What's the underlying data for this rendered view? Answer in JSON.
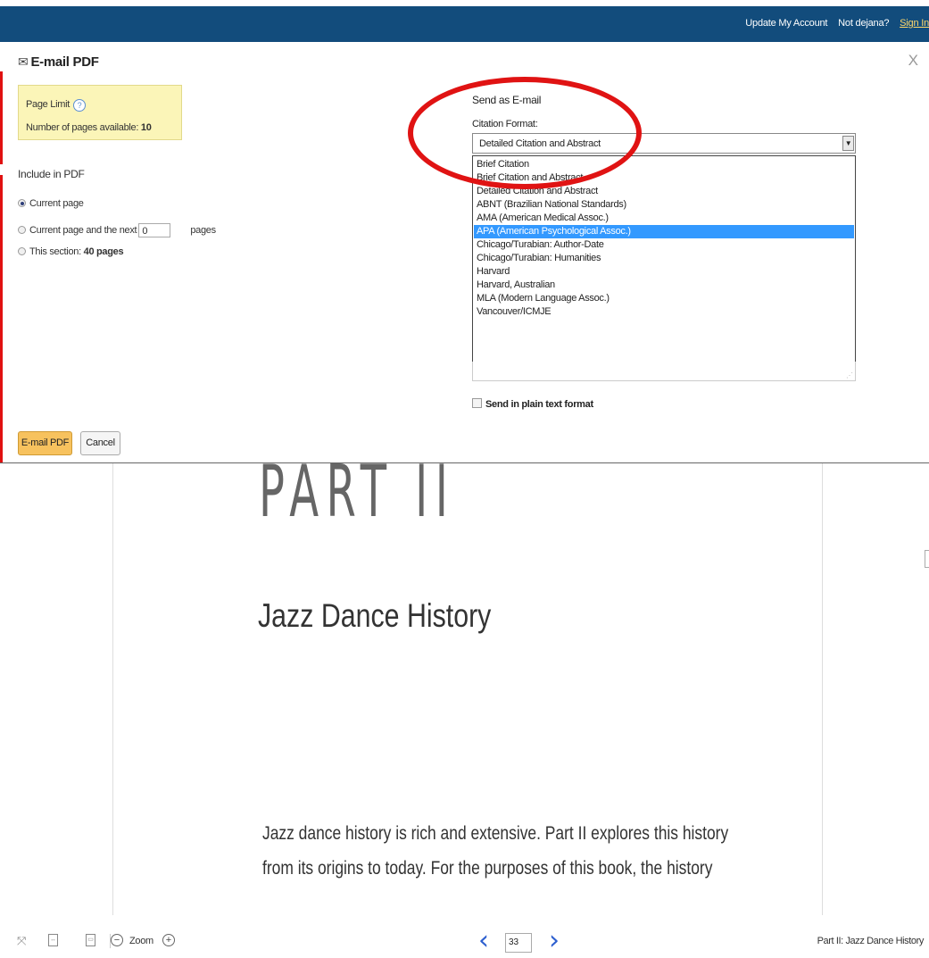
{
  "header": {
    "update_account": "Update My Account",
    "not_user": "Not dejana?",
    "sign_in": "Sign In"
  },
  "dialog": {
    "title": "E-mail PDF",
    "close": "X",
    "page_limit": {
      "label": "Page Limit",
      "help": "?",
      "available_text": "Number of pages available:",
      "available_count": "10"
    },
    "include": {
      "label": "Include in PDF",
      "current_page": "Current page",
      "current_and_next_prefix": "Current page and the next",
      "next_pages_value": "0",
      "pages_suffix": "pages",
      "this_section_prefix": "This section:",
      "this_section_count": "40 pages"
    },
    "email": {
      "send_as": "Send as E-mail",
      "citation_label": "Citation Format:",
      "citation_selected": "Detailed Citation and Abstract",
      "options": [
        "Brief Citation",
        "Brief Citation and Abstract",
        "Detailed Citation and Abstract",
        "ABNT (Brazilian National Standards)",
        "AMA (American Medical Assoc.)",
        "APA (American Psychological Assoc.)",
        "Chicago/Turabian: Author-Date",
        "Chicago/Turabian: Humanities",
        "Harvard",
        "Harvard, Australian",
        "MLA (Modern Language Assoc.)",
        "Vancouver/ICMJE"
      ],
      "highlighted_option": "APA (American Psychological Assoc.)",
      "plain_text": "Send in plain text format"
    },
    "buttons": {
      "email_pdf": "E-mail PDF",
      "cancel": "Cancel"
    }
  },
  "document": {
    "part_title": "PART II",
    "chapter_title": "Jazz Dance History",
    "body_lines": [
      "Jazz dance history is rich and extensive. Part II explores this history",
      "from its origins to today. For the purposes of this book, the history"
    ]
  },
  "toolbar": {
    "zoom_label": "Zoom",
    "page_number": "33",
    "caption": "Part II: Jazz Dance History"
  },
  "colors": {
    "header_bg": "#124c7c",
    "annotation_red": "#e01313",
    "primary_button": "#f7c25e",
    "limit_box_bg": "#fbf5b8",
    "selected_option_bg": "#3399ff",
    "nav_arrow": "#2d5fcf"
  },
  "icons": [
    "envelope-icon",
    "help-icon",
    "dropdown-arrow-icon",
    "collapse-icon",
    "fit-width-icon",
    "fit-page-icon",
    "zoom-out-icon",
    "zoom-in-icon",
    "prev-page-icon",
    "next-page-icon"
  ]
}
